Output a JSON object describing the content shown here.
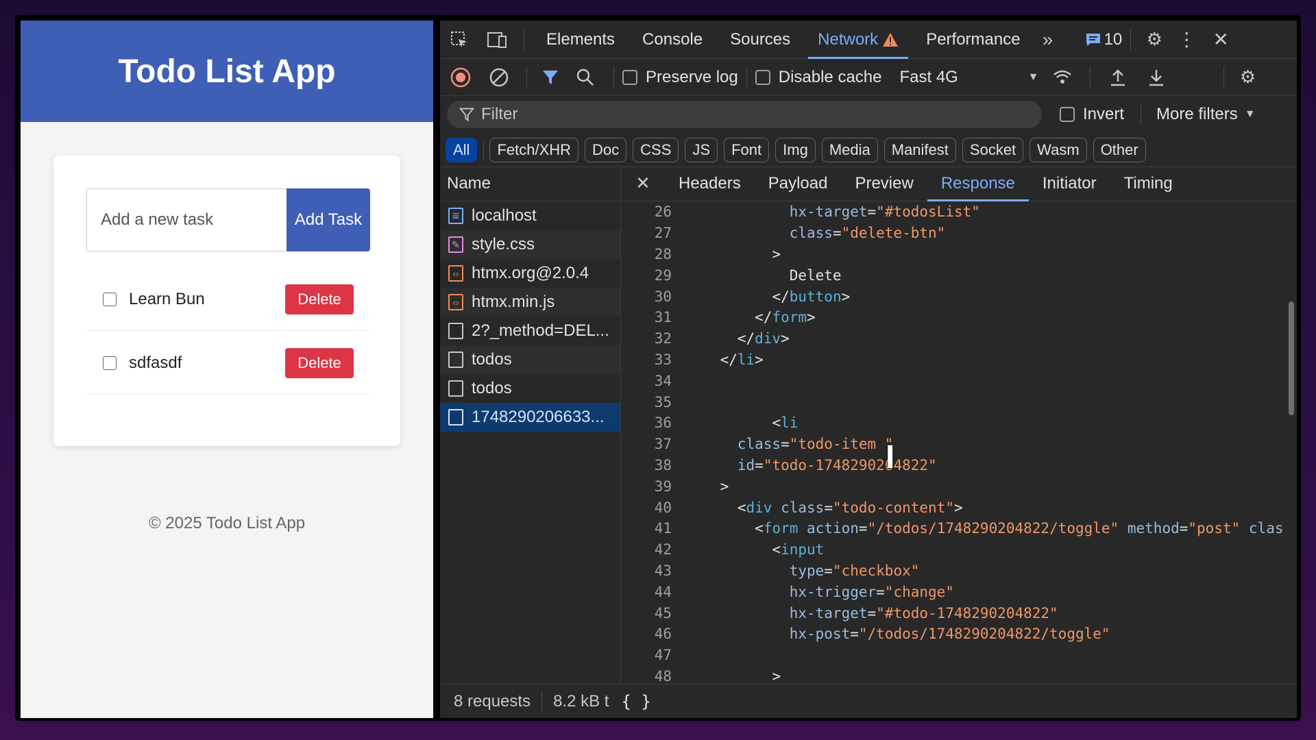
{
  "app": {
    "title": "Todo List App",
    "input_placeholder": "Add a new task",
    "add_button": "Add Task",
    "todos": [
      {
        "text": "Learn Bun",
        "delete": "Delete"
      },
      {
        "text": "sdfasdf",
        "delete": "Delete"
      }
    ],
    "footer": "© 2025 Todo List App"
  },
  "devtools": {
    "tabs": [
      "Elements",
      "Console",
      "Sources",
      "Network",
      "Performance"
    ],
    "active_tab": "Network",
    "messages_count": "10",
    "toolbar": {
      "preserve_log": "Preserve log",
      "disable_cache": "Disable cache",
      "throttle": "Fast 4G"
    },
    "filter": {
      "placeholder": "Filter",
      "invert": "Invert",
      "more_filters": "More filters"
    },
    "type_filters": [
      "All",
      "Fetch/XHR",
      "Doc",
      "CSS",
      "JS",
      "Font",
      "Img",
      "Media",
      "Manifest",
      "Socket",
      "Wasm",
      "Other"
    ],
    "name_header": "Name",
    "requests": [
      {
        "name": "localhost",
        "icon": "doc-icon"
      },
      {
        "name": "style.css",
        "icon": "css-icon"
      },
      {
        "name": "htmx.org@2.0.4",
        "icon": "script-icon"
      },
      {
        "name": "htmx.min.js",
        "icon": "script-icon"
      },
      {
        "name": "2?_method=DEL...",
        "icon": "file-icon"
      },
      {
        "name": "todos",
        "icon": "file-icon"
      },
      {
        "name": "todos",
        "icon": "file-icon"
      },
      {
        "name": "1748290206633...",
        "icon": "file-icon"
      }
    ],
    "detail_tabs": [
      "Headers",
      "Payload",
      "Preview",
      "Response",
      "Initiator",
      "Timing"
    ],
    "active_detail_tab": "Response",
    "status": {
      "requests": "8 requests",
      "transferred": "8.2 kB t"
    },
    "code_lines": [
      {
        "n": "26",
        "ind": "            ",
        "parts": [
          [
            "at",
            "hx-target"
          ],
          [
            "tx",
            "="
          ],
          [
            "av",
            "\"#todosList\""
          ]
        ]
      },
      {
        "n": "27",
        "ind": "            ",
        "parts": [
          [
            "at",
            "class"
          ],
          [
            "tx",
            "="
          ],
          [
            "av",
            "\"delete-btn\""
          ]
        ]
      },
      {
        "n": "28",
        "ind": "          ",
        "parts": [
          [
            "tx",
            ">"
          ]
        ]
      },
      {
        "n": "29",
        "ind": "            ",
        "parts": [
          [
            "tx",
            "Delete"
          ]
        ]
      },
      {
        "n": "30",
        "ind": "          ",
        "parts": [
          [
            "tx",
            "</"
          ],
          [
            "tg",
            "button"
          ],
          [
            "tx",
            ">"
          ]
        ]
      },
      {
        "n": "31",
        "ind": "        ",
        "parts": [
          [
            "tx",
            "</"
          ],
          [
            "tg",
            "form"
          ],
          [
            "tx",
            ">"
          ]
        ]
      },
      {
        "n": "32",
        "ind": "      ",
        "parts": [
          [
            "tx",
            "</"
          ],
          [
            "tg",
            "div"
          ],
          [
            "tx",
            ">"
          ]
        ]
      },
      {
        "n": "33",
        "ind": "    ",
        "parts": [
          [
            "tx",
            "</"
          ],
          [
            "tg",
            "li"
          ],
          [
            "tx",
            ">"
          ]
        ]
      },
      {
        "n": "34",
        "ind": "",
        "parts": []
      },
      {
        "n": "35",
        "ind": "",
        "parts": []
      },
      {
        "n": "36",
        "ind": "          ",
        "parts": [
          [
            "tx",
            "<"
          ],
          [
            "tg",
            "li"
          ]
        ]
      },
      {
        "n": "37",
        "ind": "      ",
        "parts": [
          [
            "at",
            "class"
          ],
          [
            "tx",
            "="
          ],
          [
            "av",
            "\"todo-item \""
          ]
        ]
      },
      {
        "n": "38",
        "ind": "      ",
        "parts": [
          [
            "at",
            "id"
          ],
          [
            "tx",
            "="
          ],
          [
            "av",
            "\"todo-1748290204822\""
          ]
        ]
      },
      {
        "n": "39",
        "ind": "    ",
        "parts": [
          [
            "tx",
            ">"
          ]
        ]
      },
      {
        "n": "40",
        "ind": "      ",
        "parts": [
          [
            "tx",
            "<"
          ],
          [
            "tg",
            "div"
          ],
          [
            "tx",
            " "
          ],
          [
            "at",
            "class"
          ],
          [
            "tx",
            "="
          ],
          [
            "av",
            "\"todo-content\""
          ],
          [
            "tx",
            ">"
          ]
        ]
      },
      {
        "n": "41",
        "ind": "        ",
        "parts": [
          [
            "tx",
            "<"
          ],
          [
            "tg",
            "form"
          ],
          [
            "tx",
            " "
          ],
          [
            "at",
            "action"
          ],
          [
            "tx",
            "="
          ],
          [
            "av",
            "\"/todos/1748290204822/toggle\""
          ],
          [
            "tx",
            " "
          ],
          [
            "at",
            "method"
          ],
          [
            "tx",
            "="
          ],
          [
            "av",
            "\"post\""
          ],
          [
            "tx",
            " "
          ],
          [
            "at",
            "clas"
          ]
        ]
      },
      {
        "n": "42",
        "ind": "          ",
        "parts": [
          [
            "tx",
            "<"
          ],
          [
            "tg",
            "input"
          ]
        ]
      },
      {
        "n": "43",
        "ind": "            ",
        "parts": [
          [
            "at",
            "type"
          ],
          [
            "tx",
            "="
          ],
          [
            "av",
            "\"checkbox\""
          ]
        ]
      },
      {
        "n": "44",
        "ind": "            ",
        "parts": [
          [
            "at",
            "hx-trigger"
          ],
          [
            "tx",
            "="
          ],
          [
            "av",
            "\"change\""
          ]
        ]
      },
      {
        "n": "45",
        "ind": "            ",
        "parts": [
          [
            "at",
            "hx-target"
          ],
          [
            "tx",
            "="
          ],
          [
            "av",
            "\"#todo-1748290204822\""
          ]
        ]
      },
      {
        "n": "46",
        "ind": "            ",
        "parts": [
          [
            "at",
            "hx-post"
          ],
          [
            "tx",
            "="
          ],
          [
            "av",
            "\"/todos/1748290204822/toggle\""
          ]
        ]
      },
      {
        "n": "47",
        "ind": "",
        "parts": []
      },
      {
        "n": "48",
        "ind": "          ",
        "parts": [
          [
            "tx",
            ">"
          ]
        ]
      }
    ]
  }
}
